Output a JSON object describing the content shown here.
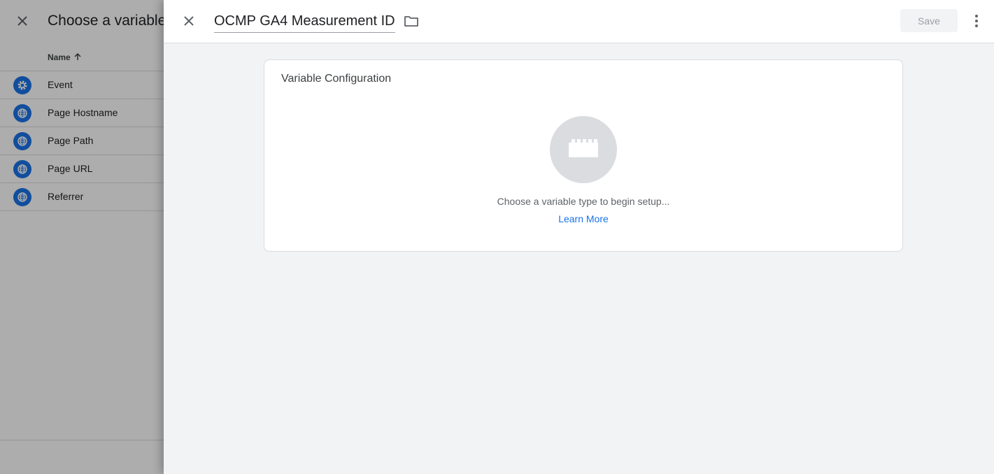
{
  "background_panel": {
    "title": "Choose a variable",
    "column_header": "Name",
    "sort_icon": "arrow-up-icon",
    "items": [
      {
        "label": "Event",
        "icon": "gear-icon"
      },
      {
        "label": "Page Hostname",
        "icon": "globe-icon"
      },
      {
        "label": "Page Path",
        "icon": "globe-icon"
      },
      {
        "label": "Page URL",
        "icon": "globe-icon"
      },
      {
        "label": "Referrer",
        "icon": "globe-icon"
      }
    ]
  },
  "editor": {
    "variable_name": "OCMP GA4 Measurement ID",
    "save_label": "Save",
    "card": {
      "title": "Variable Configuration",
      "hint": "Choose a variable type to begin setup...",
      "link": "Learn More"
    }
  },
  "colors": {
    "accent": "#1a73e8",
    "sheet_background": "#f1f3f4",
    "placeholder_circle": "#dadce0"
  }
}
